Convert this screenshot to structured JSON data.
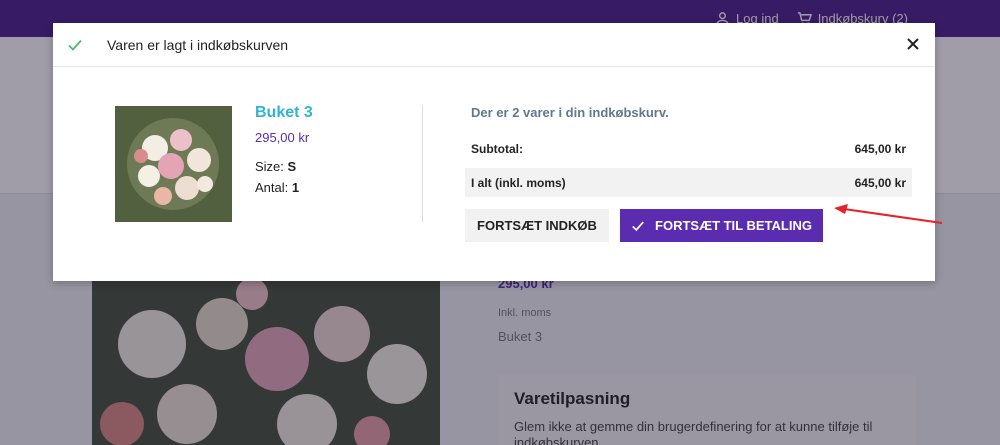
{
  "topbar": {
    "login_label": "Log ind",
    "cart_label": "Indkøbskurv (2)",
    "user_icon": "user-icon",
    "cart_icon": "cart-icon"
  },
  "background": {
    "price": "295,00 kr",
    "tax_label": "Inkl. moms",
    "product_name": "Buket 3",
    "customization": {
      "title": "Varetilpasning",
      "text": "Glem ikke at gemme din brugerdefinering for at kunne tilføje til indkøbskurven"
    }
  },
  "modal": {
    "title": "Varen er lagt i indkøbskurven",
    "check_icon": "check-icon",
    "close_icon": "close-icon",
    "product": {
      "name": "Buket 3",
      "price": "295,00 kr",
      "size_label": "Size:",
      "size_value": "S",
      "qty_label": "Antal:",
      "qty_value": "1"
    },
    "cart": {
      "count_text": "Der er 2 varer i din indkøbskurv.",
      "subtotal_label": "Subtotal:",
      "subtotal_value": "645,00 kr",
      "total_label": "I alt (inkl. moms)",
      "total_value": "645,00 kr"
    },
    "buttons": {
      "continue_label": "FORTSÆT INDKØB",
      "checkout_label": "FORTSÆT TIL BETALING"
    }
  },
  "colors": {
    "brand": "#4b1f8c",
    "button": "#5b2bb0",
    "product_name": "#2fb5d2",
    "annotation_arrow": "#e8202a"
  }
}
